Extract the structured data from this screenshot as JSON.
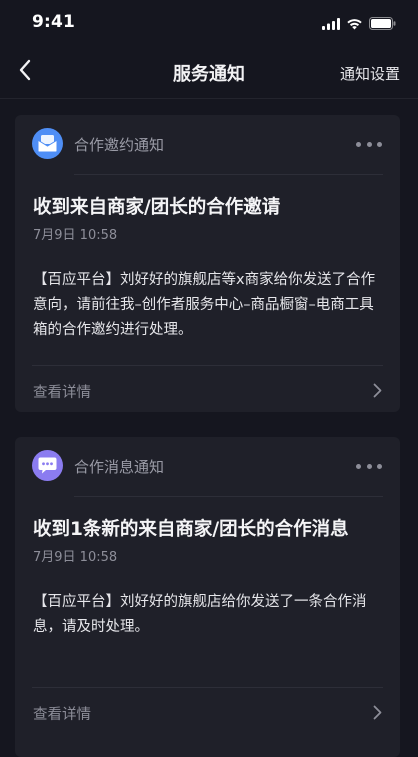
{
  "status_bar": {
    "time": "9:41",
    "icons": [
      "signal-icon",
      "wifi-icon",
      "battery-icon"
    ]
  },
  "nav": {
    "back_icon": "chevron-left-icon",
    "title": "服务通知",
    "right_action": "通知设置"
  },
  "notifications": [
    {
      "type_label": "合作邀约通知",
      "type_icon": "envelope-icon",
      "icon_color": "#4f8ef5",
      "title": "收到来自商家/团长的合作邀请",
      "time": "7月9日  10:58",
      "body": "【百应平台】刘好好的旗舰店等x商家给你发送了合作意向，请前往我–创作者服务中心–商品橱窗–电商工具箱的合作邀约进行处理。",
      "footer_label": "查看详情"
    },
    {
      "type_label": "合作消息通知",
      "type_icon": "chat-bubble-icon",
      "icon_color": "#8b7cf0",
      "title": "收到1条新的来自商家/团长的合作消息",
      "time": "7月9日  10:58",
      "body": "【百应平台】刘好好的旗舰店给你发送了一条合作消息，请及时处理。",
      "footer_label": "查看详情"
    }
  ],
  "colors": {
    "background": "#15161f",
    "card": "#1f2029",
    "muted_text": "#8d8e99"
  }
}
